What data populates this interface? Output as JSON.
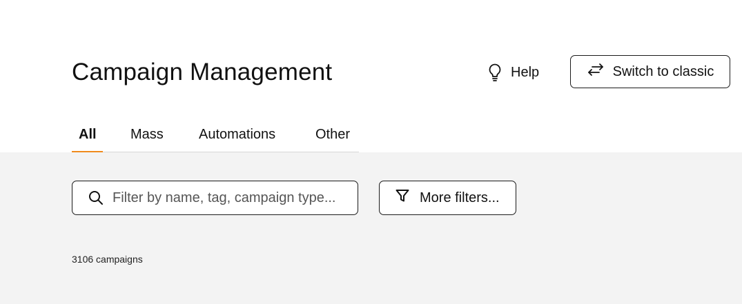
{
  "header": {
    "title": "Campaign Management",
    "help_label": "Help",
    "switch_label": "Switch to classic"
  },
  "tabs": [
    {
      "label": "All",
      "active": true
    },
    {
      "label": "Mass",
      "active": false
    },
    {
      "label": "Automations",
      "active": false
    },
    {
      "label": "Other",
      "active": false
    }
  ],
  "search": {
    "placeholder": "Filter by name, tag, campaign type...",
    "value": ""
  },
  "filters": {
    "more_label": "More filters..."
  },
  "results": {
    "count_text": "3106 campaigns"
  },
  "colors": {
    "accent": "#f08a1c",
    "background_grey": "#f3f3f3",
    "border": "#1a1a1a"
  },
  "icons": {
    "help": "lightbulb-icon",
    "switch": "swap-arrows-icon",
    "search": "search-icon",
    "filter": "filter-funnel-icon"
  }
}
